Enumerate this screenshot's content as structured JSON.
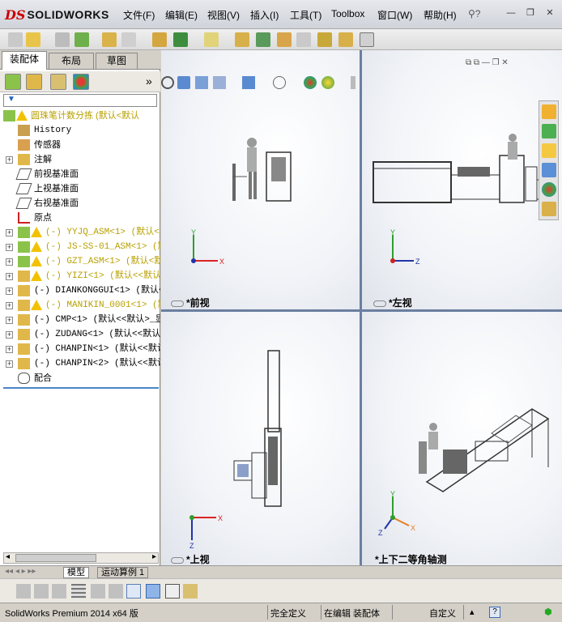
{
  "app": {
    "logo_ds": "DS",
    "logo_text": "SOLIDWORKS"
  },
  "menu": {
    "items": [
      "文件(F)",
      "编辑(E)",
      "视图(V)",
      "插入(I)",
      "工具(T)",
      "Toolbox",
      "窗口(W)",
      "帮助(H)"
    ]
  },
  "window_controls": {
    "minimize": "—",
    "restore": "❐",
    "close": "✕"
  },
  "left_panel": {
    "tabs": [
      "装配体",
      "布局",
      "草图"
    ],
    "expand_glyph": "»",
    "filter_glyph": "▼",
    "tree": [
      {
        "label": "圆珠笔计数分拣  (默认<默认",
        "style": "yellow",
        "indent": 0,
        "icon": "assembly-warning"
      },
      {
        "label": "History",
        "style": "mono",
        "indent": 1,
        "icon": "history"
      },
      {
        "label": "传感器",
        "style": "normal",
        "indent": 1,
        "icon": "sensor"
      },
      {
        "label": "注解",
        "style": "normal",
        "indent": 1,
        "icon": "annotation",
        "expand": true
      },
      {
        "label": "前视基准面",
        "style": "normal",
        "indent": 1,
        "icon": "plane"
      },
      {
        "label": "上视基准面",
        "style": "normal",
        "indent": 1,
        "icon": "plane"
      },
      {
        "label": "右视基准面",
        "style": "normal",
        "indent": 1,
        "icon": "plane"
      },
      {
        "label": "原点",
        "style": "normal",
        "indent": 1,
        "icon": "origin"
      },
      {
        "label": "(-) YYJQ_ASM<1> (默认<",
        "style": "yellow-mono",
        "indent": 1,
        "icon": "assembly-warning",
        "expand": true
      },
      {
        "label": "(-) JS-SS-01_ASM<1> (默",
        "style": "yellow-mono",
        "indent": 1,
        "icon": "assembly-warning",
        "expand": true
      },
      {
        "label": "(-) GZT_ASM<1> (默认<默认",
        "style": "yellow-mono",
        "indent": 1,
        "icon": "assembly-warning",
        "expand": true
      },
      {
        "label": "(-) YIZI<1> (默认<<默认",
        "style": "yellow-mono",
        "indent": 1,
        "icon": "part-warning",
        "expand": true
      },
      {
        "label": "(-) DIANKONGGUI<1> (默认<",
        "style": "mono",
        "indent": 1,
        "icon": "part",
        "expand": true
      },
      {
        "label": "(-) MANIKIN_0001<1> (默",
        "style": "yellow-mono",
        "indent": 1,
        "icon": "part-warning",
        "expand": true
      },
      {
        "label": "(-) CMP<1> (默认<<默认>_显",
        "style": "mono",
        "indent": 1,
        "icon": "part",
        "expand": true
      },
      {
        "label": "(-) ZUDANG<1> (默认<<默认",
        "style": "mono",
        "indent": 1,
        "icon": "part",
        "expand": true
      },
      {
        "label": "(-) CHANPIN<1> (默认<<默认",
        "style": "mono",
        "indent": 1,
        "icon": "part",
        "expand": true
      },
      {
        "label": "(-) CHANPIN<2> (默认<<默认",
        "style": "mono",
        "indent": 1,
        "icon": "part",
        "expand": true
      },
      {
        "label": "配合",
        "style": "normal",
        "indent": 1,
        "icon": "mates"
      }
    ]
  },
  "viewports": {
    "front": "*前视",
    "left": "*左视",
    "top": "*上视",
    "iso": "*上下二等角轴测"
  },
  "axes": {
    "x": "X",
    "y": "Y",
    "z": "Z"
  },
  "bottom_tabs": [
    "模型",
    "运动算例 1"
  ],
  "status": {
    "version": "SolidWorks Premium 2014 x64 版",
    "definition": "完全定义",
    "editing": "在编辑 装配体",
    "units": "自定义",
    "help": "?"
  }
}
